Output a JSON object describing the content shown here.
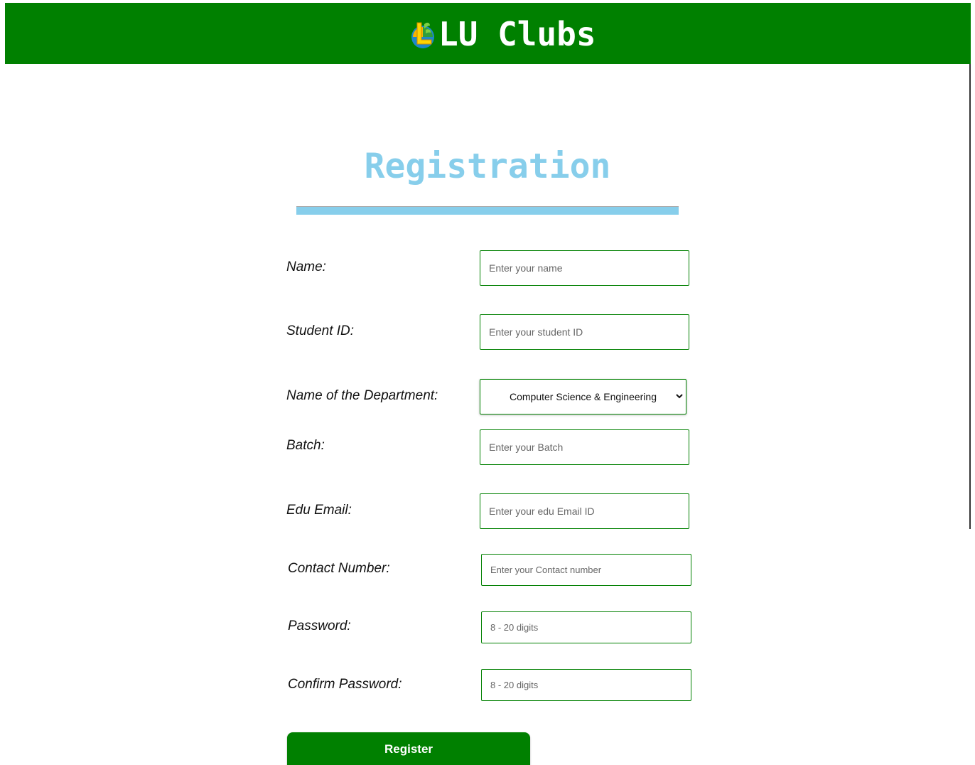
{
  "header": {
    "brand_text": "LU Clubs",
    "background_color": "#008000",
    "logo_icon": "lu-clubs-logo-icon"
  },
  "form": {
    "title": "Registration",
    "title_color": "#87ceeb",
    "fields": [
      {
        "label": "Name:",
        "placeholder": "Enter your name",
        "value": ""
      },
      {
        "label": "Student ID:",
        "placeholder": "Enter your student ID",
        "value": ""
      },
      {
        "label": "Name of the Department:",
        "selected": "Computer Science & Engineering"
      },
      {
        "label": "Batch:",
        "placeholder": "Enter your Batch",
        "value": ""
      },
      {
        "label": "Edu Email:",
        "placeholder": "Enter your edu Email ID",
        "value": ""
      },
      {
        "label": "Contact Number:",
        "placeholder": "Enter your Contact number",
        "value": ""
      },
      {
        "label": "Password:",
        "placeholder": "8 - 20 digits",
        "value": ""
      },
      {
        "label": "Confirm Password:",
        "placeholder": "8 - 20 digits",
        "value": ""
      }
    ],
    "submit_label": "Register",
    "accent_color": "#008000"
  }
}
